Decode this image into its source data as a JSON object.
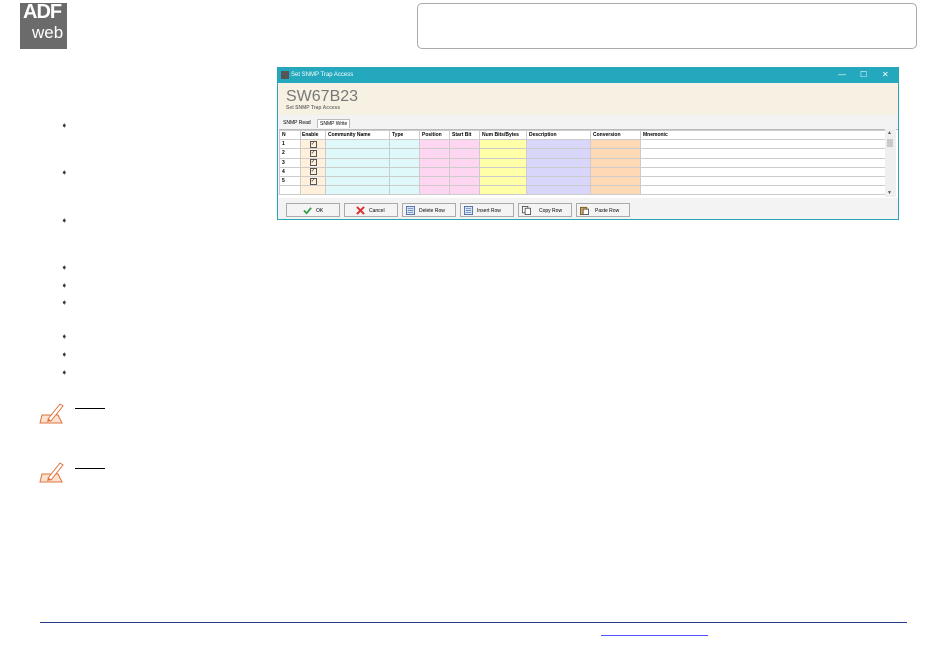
{
  "logo": {
    "line1": "ADF",
    "line2": "web"
  },
  "window": {
    "title": "Set SNMP Trap Access",
    "controls": {
      "minimize": "—",
      "maximize": "☐",
      "close": "✕"
    },
    "app_name": "SW67B23",
    "app_subtitle": "Set SNMP Trap Access",
    "tabs": [
      "SNMP Read",
      "SNMP Write"
    ],
    "columns": [
      "N",
      "Enable",
      "Community Name",
      "Type",
      "Position",
      "Start Bit",
      "Num Bits/Bytes",
      "Description",
      "Conversion",
      "Mnemonic"
    ],
    "rows": [
      {
        "n": "1",
        "enabled": true
      },
      {
        "n": "2",
        "enabled": true
      },
      {
        "n": "3",
        "enabled": true
      },
      {
        "n": "4",
        "enabled": true
      },
      {
        "n": "5",
        "enabled": true
      }
    ],
    "buttons": {
      "ok": "OK",
      "cancel": "Cancel",
      "delete_row": "Delete Row",
      "insert_row": "Insert Row",
      "copy_row": "Copy Row",
      "paste_row": "Paste Row"
    }
  },
  "bullet_glyph": "➧",
  "colors": {
    "titlebar": "#23a8bd",
    "app_header": "#f6f1e2",
    "col_enable": "#fff0dc",
    "col_community": "#dff9fb",
    "col_position": "#ffd6f2",
    "col_numbits": "#ffffa8",
    "col_description": "#d8d6fb",
    "col_conversion": "#ffd9b5",
    "footer_line": "#223b84"
  }
}
